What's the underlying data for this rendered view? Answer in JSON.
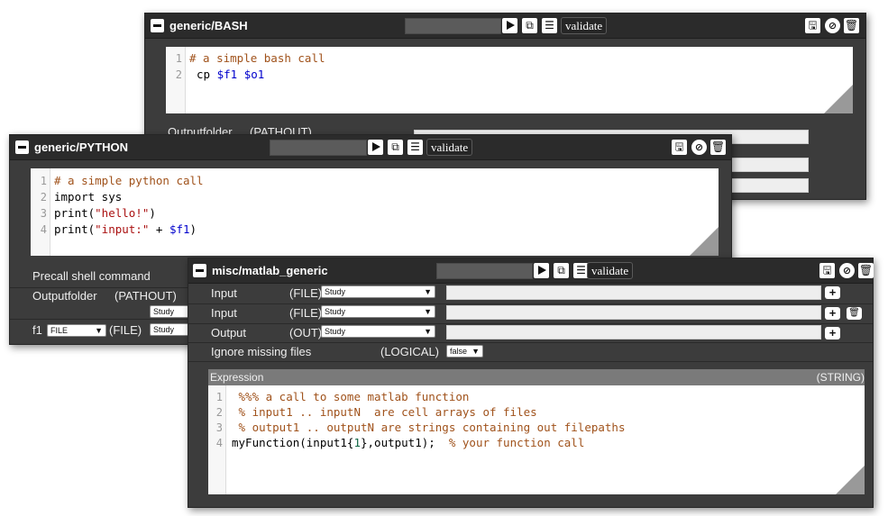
{
  "bash": {
    "title": "generic/BASH",
    "validate": "validate",
    "lines": [
      "1",
      "2"
    ],
    "code1": "# a simple bash call",
    "code2_pre": "cp ",
    "code2_v1": "$f1",
    "code2_sp": " ",
    "code2_v2": "$o1",
    "row_output_label": "Outputfolder",
    "row_output_type": "(PATHOUT)"
  },
  "python": {
    "title": "generic/PYTHON",
    "validate": "validate",
    "lines": [
      "1",
      "2",
      "3",
      "4"
    ],
    "code1": "# a simple python call",
    "code2": "import sys",
    "code3_pre": "print(",
    "code3_str": "\"hello!\"",
    "code3_post": ")",
    "code4_pre": "print(",
    "code4_str": "\"input:\"",
    "code4_mid": " + ",
    "code4_var": "$f1",
    "code4_post": ")",
    "precall_label": "Precall shell command",
    "output_label": "Outputfolder",
    "output_type": "(PATHOUT)",
    "output_select": "Study",
    "f1_label": "f1",
    "f1_select": "FILE",
    "f1_type": "(FILE)",
    "f1_study": "Study"
  },
  "matlab": {
    "title": "misc/matlab_generic",
    "validate": "validate",
    "rows": [
      {
        "label": "Input",
        "type": "(FILE)",
        "select": "Study"
      },
      {
        "label": "Input",
        "type": "(FILE)",
        "select": "Study"
      },
      {
        "label": "Output",
        "type": "(OUT)",
        "select": "Study"
      }
    ],
    "ignore_label": "Ignore missing files",
    "ignore_type": "(LOGICAL)",
    "ignore_value": "false",
    "expr_label": "Expression",
    "expr_type": "(STRING)",
    "lines": [
      "1",
      "2",
      "3",
      "4"
    ],
    "code1": " %%% a call to some matlab function",
    "code2": " % input1 .. inputN  are cell arrays of files",
    "code3": " % output1 .. outputN are strings containing out filepaths",
    "code4_a": "myFunction(input1{",
    "code4_n": "1",
    "code4_b": "},output1);  ",
    "code4_c": "% your function call"
  },
  "icons": {
    "play": "play-icon",
    "copy": "copy-icon",
    "menu": "menu-icon",
    "save": "save-icon",
    "disable": "disable-icon",
    "delete": "trash-icon",
    "collapse": "minus-icon",
    "add": "plus-icon"
  }
}
